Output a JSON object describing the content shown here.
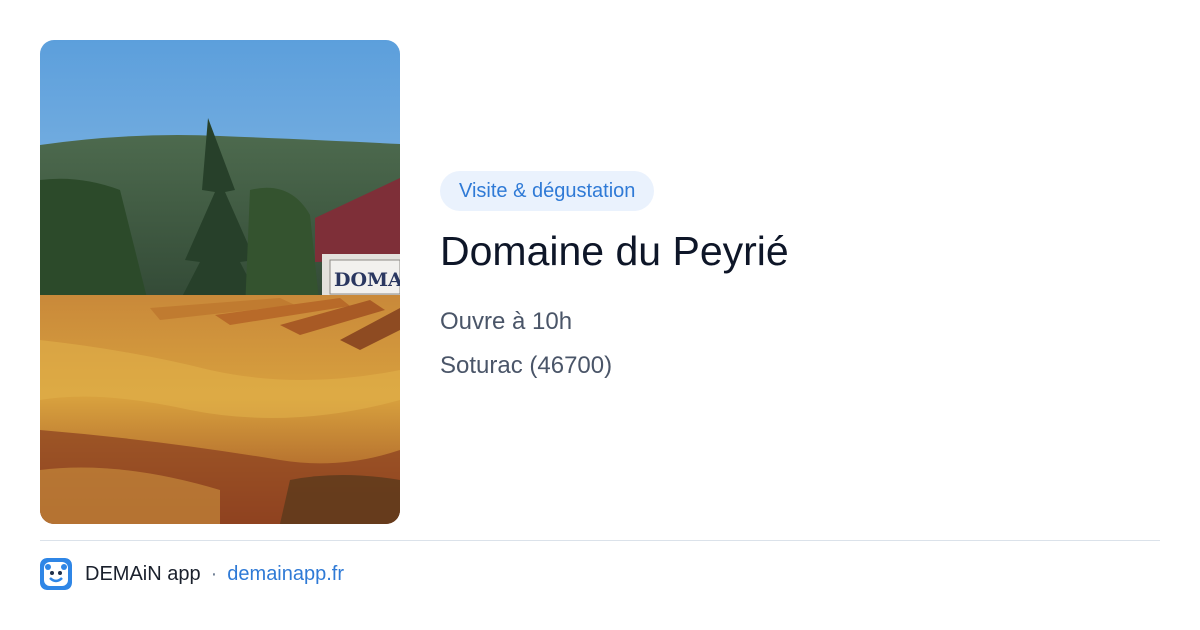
{
  "photo": {
    "alt": "Domaine du Peyrié",
    "sign_text": "DOMAIN"
  },
  "card": {
    "badge": "Visite & dégustation",
    "title": "Domaine du Peyrié",
    "hours": "Ouvre à 10h",
    "location": "Soturac (46700)"
  },
  "footer": {
    "app_name": "DEMAiN app",
    "separator": "·",
    "url": "demainapp.fr",
    "icon": "demain-logo-icon"
  },
  "colors": {
    "accent": "#2f7ad6",
    "badge_bg": "#eaf2fd",
    "title": "#0e1628",
    "meta": "#4a5568"
  }
}
